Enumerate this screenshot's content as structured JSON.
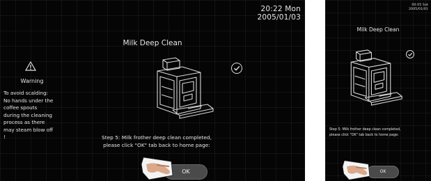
{
  "left_screen": {
    "clock": {
      "time_day": "20:22  Mon",
      "date": "2005/01/03"
    },
    "title": "Milk Deep Clean",
    "warning": {
      "icon": "warning-triangle-icon",
      "title": "Warning",
      "lines": [
        "To avoid scalding:",
        "No hands under the",
        "coffee spouts",
        "during the cleaning",
        "process as there",
        "may steam blow off",
        "!"
      ]
    },
    "machine_icon": "coffee-machine-icon",
    "check_icon": "check-circle-icon",
    "step_lines": [
      "Step 5: Milk frother deep clean completed,",
      "please click \"OK\" tab back to home page:"
    ],
    "ok_label": "OK",
    "hand_icon": "pointing-hand-icon"
  },
  "right_screen": {
    "clock": {
      "time_day": "00:05   Sat",
      "date": "2005/01/01"
    },
    "title": "Milk Deep Clean",
    "machine_icon": "coffee-machine-icon",
    "check_icon": "check-circle-icon",
    "step_lines": [
      "Step 5: Milk frother deep clean completed,",
      "please click \"OK\" tab back to home page:"
    ],
    "ok_label": "OK",
    "hand_icon": "pointing-hand-icon"
  }
}
